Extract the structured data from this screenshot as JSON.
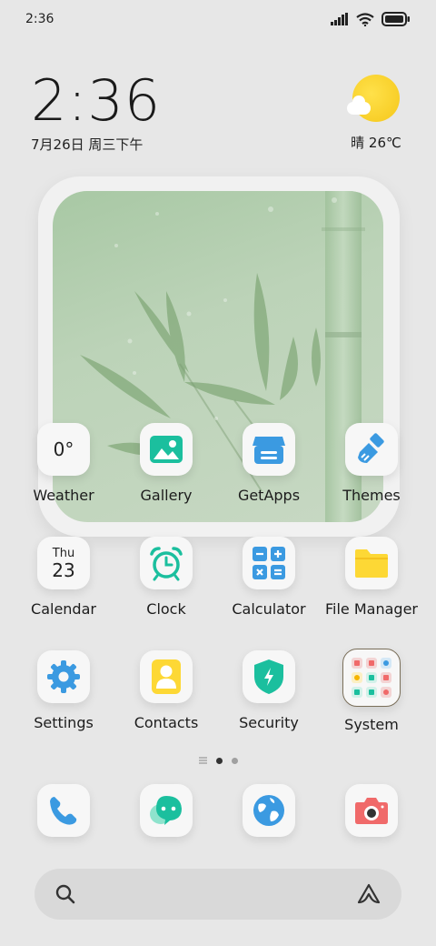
{
  "status_bar": {
    "time": "2:36",
    "icons": [
      "signal-icon",
      "wifi-icon",
      "battery-icon"
    ]
  },
  "clock_widget": {
    "time": "2:36",
    "date": "7月26日 周三下午"
  },
  "weather_widget": {
    "icon": "sunny-icon",
    "text": "晴 26℃"
  },
  "photo_widget": {
    "subject": "bamboo-photo"
  },
  "apps_row1": [
    {
      "name": "weather",
      "label": "Weather",
      "icon_text": "0°"
    },
    {
      "name": "gallery",
      "label": "Gallery"
    },
    {
      "name": "getapps",
      "label": "GetApps"
    },
    {
      "name": "themes",
      "label": "Themes"
    }
  ],
  "apps_row2": [
    {
      "name": "calendar",
      "label": "Calendar",
      "day": "Thu",
      "date": "23"
    },
    {
      "name": "clock",
      "label": "Clock"
    },
    {
      "name": "calculator",
      "label": "Calculator"
    },
    {
      "name": "file-manager",
      "label": "File Manager"
    }
  ],
  "apps_row3": [
    {
      "name": "settings",
      "label": "Settings"
    },
    {
      "name": "contacts",
      "label": "Contacts"
    },
    {
      "name": "security",
      "label": "Security"
    },
    {
      "name": "system",
      "label": "System"
    }
  ],
  "page_indicator": {
    "pages": 2,
    "current": 1
  },
  "dock": [
    "phone-icon",
    "messages-icon",
    "browser-icon",
    "camera-icon"
  ],
  "colors": {
    "accent_teal": "#1bbf9e",
    "accent_blue": "#3b9ae1",
    "yellow": "#fdd835",
    "red": "#f06a6a"
  }
}
